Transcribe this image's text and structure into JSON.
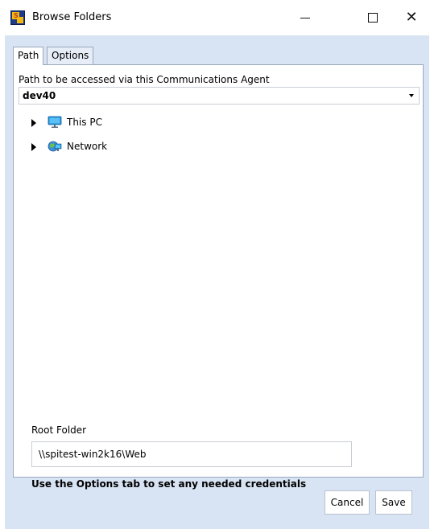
{
  "window": {
    "title": "Browse Folders",
    "icon": "app-logo-icon",
    "controls": {
      "minimize": "minimize-icon",
      "maximize": "maximize-icon",
      "close": "✕"
    }
  },
  "tabs": [
    {
      "label": "Path",
      "active": true
    },
    {
      "label": "Options",
      "active": false
    }
  ],
  "path_section": {
    "label": "Path to be accessed via this Communications Agent",
    "selected_value": "dev40"
  },
  "tree": [
    {
      "label": "This PC",
      "icon": "monitor-icon",
      "expanded": false
    },
    {
      "label": "Network",
      "icon": "network-icon",
      "expanded": false
    }
  ],
  "root_folder": {
    "label": "Root Folder",
    "value": "\\\\spitest-win2k16\\Web"
  },
  "hint": "Use the Options tab to set any needed credentials",
  "buttons": {
    "cancel": "Cancel",
    "save": "Save"
  },
  "colors": {
    "client_background": "#d8e3f3",
    "panel_border": "#9aa8bd",
    "monitor_blue": "#1e90d8"
  }
}
